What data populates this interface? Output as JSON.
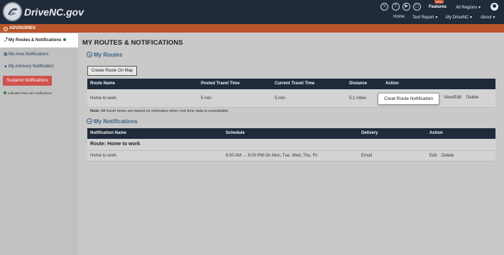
{
  "header": {
    "brand": "DriveNC.gov",
    "features": "Features",
    "new_badge": "NEW",
    "regions": "All Regions ▾",
    "nav": [
      "Home",
      "Text Report ▾",
      "My DriveNC ▾",
      "About ▾"
    ],
    "social": [
      "x-icon",
      "facebook-icon",
      "youtube-icon",
      "instagram-icon"
    ]
  },
  "advisories": {
    "label": "ADVISORIES"
  },
  "sidebar": {
    "items": [
      {
        "label": "My Routes & Notifications",
        "icon": "route-icon"
      },
      {
        "label": "My Area Notifications",
        "icon": "map-icon"
      },
      {
        "label": "My Advisory Notification",
        "icon": "warning-icon"
      }
    ],
    "suspend_label": "Suspend Notifications",
    "legend": "Indicates there are notifications"
  },
  "main": {
    "title": "MY ROUTES & NOTIFICATIONS",
    "routes_heading": "My Routes",
    "create_label": "Create Route On Map",
    "routes_columns": [
      "Route Name",
      "Posted Travel Time",
      "Current Travel Time",
      "Distance",
      "Action"
    ],
    "routes_rows": [
      {
        "name": "Home to work",
        "posted": "5 min",
        "current": "5 min",
        "distance": "5.1 miles",
        "view_edit": "View/Edit",
        "delete": "Delete"
      }
    ],
    "tooltip": "Creat Route Notification",
    "note_label": "Note:",
    "note_text": " All travel times are based on estimates when real time data is unavailable.",
    "notifications_heading": "My Notifications",
    "notif_columns": [
      "Notification Name",
      "Schedule",
      "Delivery",
      "Action"
    ],
    "route_group": "Route: Home to work",
    "notif_rows": [
      {
        "name": "Home to work",
        "schedule": "6:00 AM → 6:00 PM On Mon, Tue, Wed, Thu, Fri",
        "delivery": "Email",
        "edit": "Edit",
        "delete": "Delete"
      }
    ]
  },
  "colors": {
    "header_bg": "#1f2b3a",
    "advisory_bar": "#b9552a",
    "suspend_button": "#d0524f",
    "notification_dot": "#2e7d32"
  }
}
